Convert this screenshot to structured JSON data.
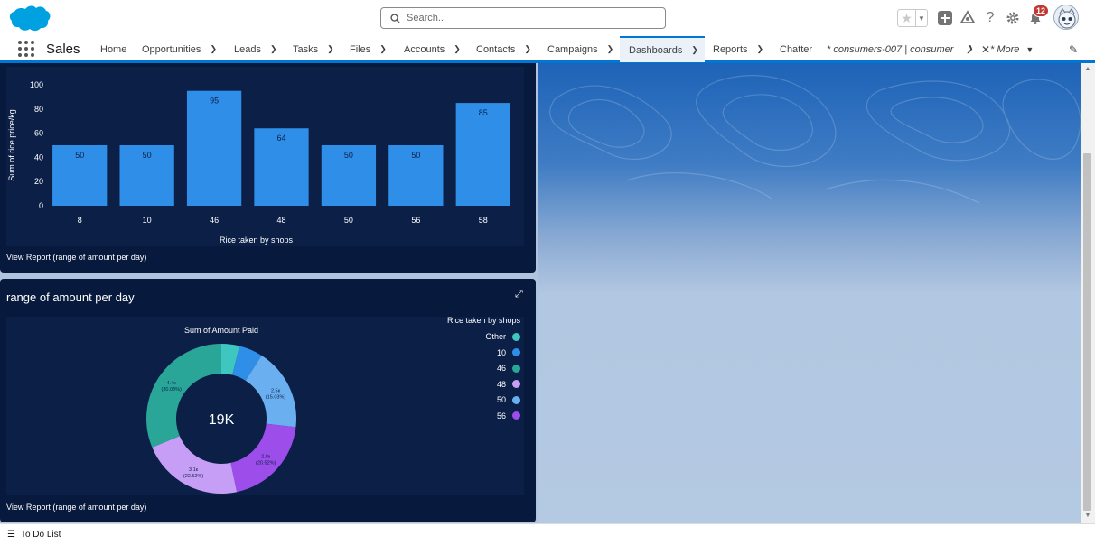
{
  "search": {
    "placeholder": "Search..."
  },
  "header": {
    "notification_count": "12"
  },
  "app": {
    "name": "Sales"
  },
  "nav": {
    "items": [
      {
        "label": "Home",
        "dropdown": false
      },
      {
        "label": "Opportunities",
        "dropdown": true
      },
      {
        "label": "Leads",
        "dropdown": true
      },
      {
        "label": "Tasks",
        "dropdown": true
      },
      {
        "label": "Files",
        "dropdown": true
      },
      {
        "label": "Accounts",
        "dropdown": true
      },
      {
        "label": "Contacts",
        "dropdown": true
      },
      {
        "label": "Campaigns",
        "dropdown": true
      },
      {
        "label": "Dashboards",
        "dropdown": true,
        "active": true
      },
      {
        "label": "Reports",
        "dropdown": true
      },
      {
        "label": "Chatter",
        "dropdown": false
      }
    ],
    "record_tab": "* consumers-007 | consumer",
    "more": "* More"
  },
  "card1": {
    "view_report": "View Report (range of amount per day)"
  },
  "card2": {
    "title": "range of amount per day",
    "view_report": "View Report (range of amount per day)",
    "donut_center": "19K",
    "legend_title": "Rice taken by shops"
  },
  "chart_data": [
    {
      "type": "bar",
      "categories": [
        "8",
        "10",
        "46",
        "48",
        "50",
        "56",
        "58"
      ],
      "values": [
        50,
        50,
        95,
        64,
        50,
        50,
        85
      ],
      "xlabel": "Rice taken by shops",
      "ylabel": "Sum of rice price/kg",
      "ylim": [
        0,
        100
      ],
      "yticks": [
        0,
        20,
        40,
        60,
        80,
        100
      ],
      "bar_color": "#2f8fe8"
    },
    {
      "type": "pie",
      "title": "Sum of Amount Paid",
      "center_label": "19K",
      "legend_title": "Rice taken by shops",
      "slices": [
        {
          "label": "Other",
          "value": 0.55,
          "color": "#3ec6c0",
          "data_label": ""
        },
        {
          "label": "10",
          "value": 0.72,
          "color": "#2f8fe8",
          "data_label": ""
        },
        {
          "label": "46",
          "value": 2.5,
          "color": "#6ab0f0",
          "data_label": "2.5к",
          "data_pct": "(15.03%)"
        },
        {
          "label": "48",
          "value": 2.8,
          "color": "#9c4dea",
          "data_label": "2.8к",
          "data_pct": "(20.52%)"
        },
        {
          "label": "50",
          "value": 3.1,
          "color": "#c79ef5",
          "data_label": "3.1к",
          "data_pct": "(22.52%)"
        },
        {
          "label": "56",
          "value": 4.4,
          "color": "#2aa698",
          "data_label": "4.4к",
          "data_pct": "(30.03%)"
        }
      ],
      "legend": [
        {
          "label": "Other",
          "color": "#3ec6c0"
        },
        {
          "label": "10",
          "color": "#2f8fe8"
        },
        {
          "label": "46",
          "color": "#2aa698"
        },
        {
          "label": "48",
          "color": "#c79ef5"
        },
        {
          "label": "50",
          "color": "#6ab0f0"
        },
        {
          "label": "56",
          "color": "#9c4dea"
        }
      ]
    }
  ],
  "bottombar": {
    "todo_label": "To Do List"
  }
}
